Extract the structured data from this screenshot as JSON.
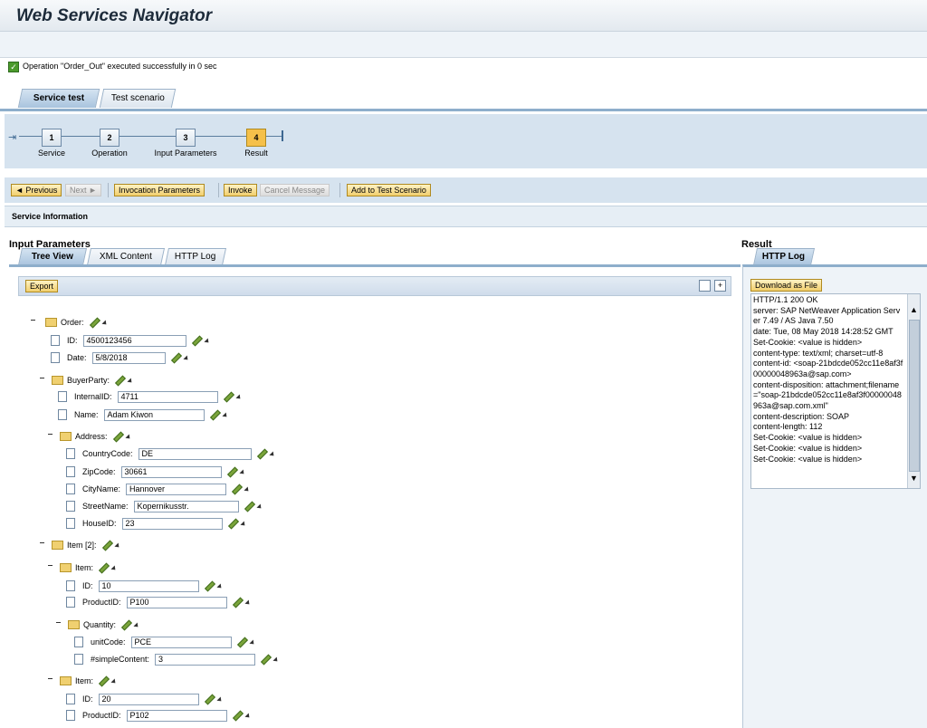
{
  "app": {
    "title": "Web Services Navigator"
  },
  "message": {
    "text": "Operation \"Order_Out\" executed successfully in 0 sec"
  },
  "tabs": [
    {
      "label": "Service test"
    },
    {
      "label": "Test scenario"
    }
  ],
  "roadmap": {
    "steps": [
      {
        "num": "1",
        "label": "Service"
      },
      {
        "num": "2",
        "label": "Operation"
      },
      {
        "num": "3",
        "label": "Input Parameters"
      },
      {
        "num": "4",
        "label": "Result"
      }
    ]
  },
  "actions": {
    "previous": "◄ Previous",
    "next": "Next ►",
    "invocation_parameters": "Invocation Parameters",
    "invoke": "Invoke",
    "cancel_message": "Cancel Message",
    "add_to_test_scenario": "Add to Test Scenario"
  },
  "service_information": {
    "label": "Service Information"
  },
  "input_parameters": {
    "title": "Input Parameters",
    "tabs": [
      {
        "label": "Tree View"
      },
      {
        "label": "XML Content"
      },
      {
        "label": "HTTP Log"
      }
    ],
    "export_label": "Export",
    "tree": {
      "order": "Order:",
      "id_label": "ID:",
      "id_value": "4500123456",
      "date_label": "Date:",
      "date_value": "5/8/2018",
      "buyer_party": "BuyerParty:",
      "internal_id_label": "InternalID:",
      "internal_id_value": "4711",
      "name_label": "Name:",
      "name_value": "Adam Kiwon",
      "address": "Address:",
      "country_code_label": "CountryCode:",
      "country_code_value": "DE",
      "zip_code_label": "ZipCode:",
      "zip_code_value": "30661",
      "city_name_label": "CityName:",
      "city_name_value": "Hannover",
      "street_name_label": "StreetName:",
      "street_name_value": "Kopernikusstr.",
      "house_id_label": "HouseID:",
      "house_id_value": "23",
      "item_list": "Item [2]:",
      "item1": "Item:",
      "item1_id_label": "ID:",
      "item1_id_value": "10",
      "item1_product_label": "ProductID:",
      "item1_product_value": "P100",
      "quantity": "Quantity:",
      "unit_code_label": "unitCode:",
      "unit_code_value": "PCE",
      "simple_content_label": "#simpleContent:",
      "simple_content_value": "3",
      "item2": "Item:",
      "item2_id_label": "ID:",
      "item2_id_value": "20",
      "item2_product_label": "ProductID:",
      "item2_product_value": "P102"
    }
  },
  "result": {
    "title": "Result",
    "tab": "HTTP Log",
    "download_label": "Download as File",
    "http_log": "HTTP/1.1 200 OK\nserver: SAP NetWeaver Application Server 7.49 / AS Java 7.50\ndate: Tue, 08 May 2018 14:28:52 GMT\nSet-Cookie: <value is hidden>\ncontent-type: text/xml; charset=utf-8\ncontent-id: <soap-21bdcde052cc11e8af3f00000048963a@sap.com>\ncontent-disposition: attachment;filename=\"soap-21bdcde052cc11e8af3f00000048963a@sap.com.xml\"\ncontent-description: SOAP\ncontent-length: 112\nSet-Cookie: <value is hidden>\nSet-Cookie: <value is hidden>\nSet-Cookie: <value is hidden>"
  }
}
